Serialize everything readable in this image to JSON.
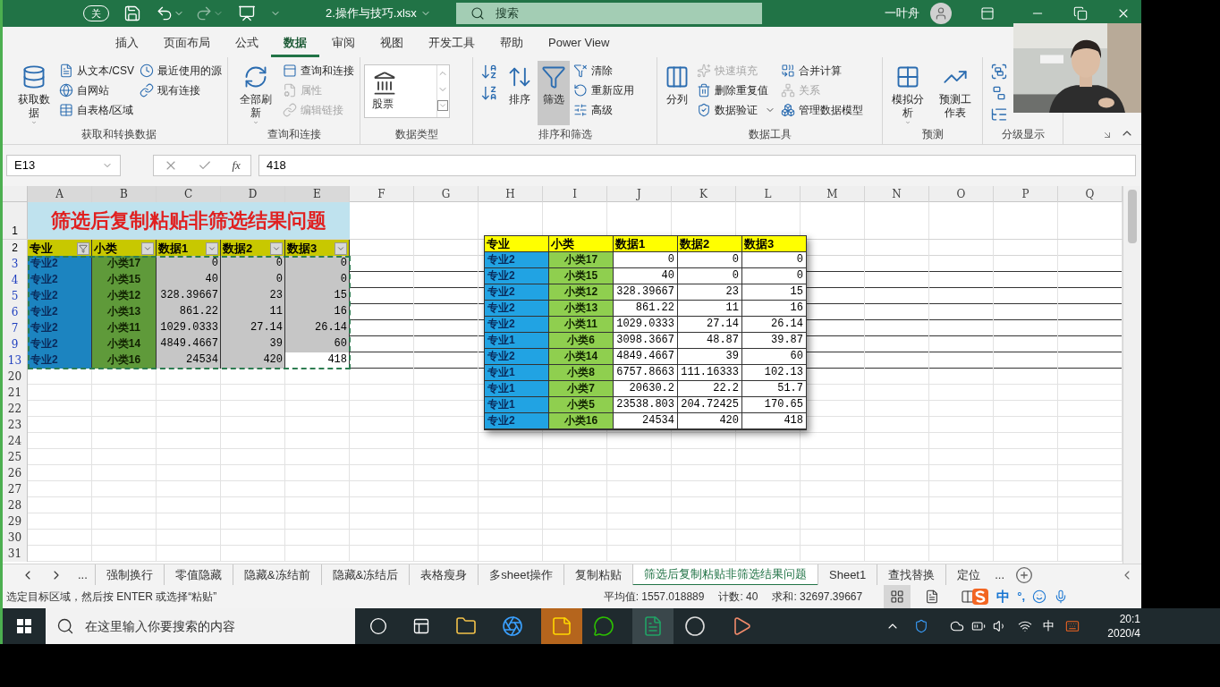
{
  "title_bar": {
    "autosave": "关",
    "filename": "2.操作与技巧.xlsx",
    "search": "搜索",
    "user": "一叶舟"
  },
  "ribbon_tabs": [
    {
      "label": "插入",
      "selected": false
    },
    {
      "label": "页面布局",
      "selected": false
    },
    {
      "label": "公式",
      "selected": false
    },
    {
      "label": "数据",
      "selected": true
    },
    {
      "label": "审阅",
      "selected": false
    },
    {
      "label": "视图",
      "selected": false
    },
    {
      "label": "开发工具",
      "selected": false
    },
    {
      "label": "帮助",
      "selected": false
    },
    {
      "label": "Power View",
      "selected": false
    }
  ],
  "ribbon": [
    {
      "label": "获取和转换数据",
      "columns": [
        [
          {
            "kind": "large",
            "label": "获取数据",
            "dropdown": true,
            "disabled": false,
            "pressed": false
          }
        ],
        [
          {
            "kind": "small",
            "label": "从文本/CSV",
            "dropdown": false,
            "disabled": false,
            "pressed": false
          },
          {
            "kind": "small",
            "label": "自网站",
            "dropdown": false,
            "disabled": false,
            "pressed": false
          },
          {
            "kind": "small",
            "label": "自表格/区域",
            "dropdown": false,
            "disabled": false,
            "pressed": false
          }
        ],
        [
          {
            "kind": "small",
            "label": "最近使用的源",
            "dropdown": false,
            "disabled": false,
            "pressed": false
          },
          {
            "kind": "small",
            "label": "现有连接",
            "dropdown": false,
            "disabled": false,
            "pressed": false
          }
        ]
      ]
    },
    {
      "label": "查询和连接",
      "columns": [
        [
          {
            "kind": "large",
            "label": "全部刷新",
            "dropdown": true,
            "disabled": false,
            "pressed": false
          }
        ],
        [
          {
            "kind": "small",
            "label": "查询和连接",
            "dropdown": false,
            "disabled": false,
            "pressed": false
          },
          {
            "kind": "small",
            "label": "属性",
            "dropdown": false,
            "disabled": true,
            "pressed": false
          },
          {
            "kind": "small",
            "label": "编辑链接",
            "dropdown": false,
            "disabled": true,
            "pressed": false
          }
        ]
      ]
    },
    {
      "label": "数据类型",
      "columns": [
        [
          {
            "kind": "gallery",
            "label": "股票"
          }
        ]
      ]
    },
    {
      "label": "排序和筛选",
      "columns": [
        [
          {
            "kind": "icon"
          },
          {
            "kind": "icon"
          }
        ],
        [
          {
            "kind": "large",
            "label": "排序",
            "dropdown": false,
            "disabled": false,
            "pressed": false
          }
        ],
        [
          {
            "kind": "large",
            "label": "筛选",
            "dropdown": false,
            "disabled": false,
            "pressed": true
          }
        ],
        [
          {
            "kind": "small",
            "label": "清除",
            "dropdown": false,
            "disabled": false,
            "pressed": false
          },
          {
            "kind": "small",
            "label": "重新应用",
            "dropdown": false,
            "disabled": false,
            "pressed": false
          },
          {
            "kind": "small",
            "label": "高级",
            "dropdown": false,
            "disabled": false,
            "pressed": false
          }
        ]
      ]
    },
    {
      "label": "数据工具",
      "columns": [
        [
          {
            "kind": "large",
            "label": "分列",
            "dropdown": false,
            "disabled": false,
            "pressed": false
          }
        ],
        [
          {
            "kind": "small",
            "label": "快速填充",
            "dropdown": false,
            "disabled": true,
            "pressed": false
          },
          {
            "kind": "small",
            "label": "删除重复值",
            "dropdown": false,
            "disabled": false,
            "pressed": false
          },
          {
            "kind": "small",
            "label": "数据验证",
            "dropdown": true,
            "disabled": false,
            "pressed": false
          }
        ],
        [
          {
            "kind": "small",
            "label": "合并计算",
            "dropdown": false,
            "disabled": false,
            "pressed": false
          },
          {
            "kind": "small",
            "label": "关系",
            "dropdown": false,
            "disabled": true,
            "pressed": false
          },
          {
            "kind": "small",
            "label": "管理数据模型",
            "dropdown": false,
            "disabled": false,
            "pressed": false
          }
        ]
      ]
    },
    {
      "label": "预测",
      "columns": [
        [
          {
            "kind": "large",
            "label": "模拟分析",
            "dropdown": true,
            "disabled": false,
            "pressed": false
          }
        ],
        [
          {
            "kind": "large",
            "label": "预测工作表",
            "dropdown": false,
            "disabled": false,
            "pressed": false
          }
        ]
      ]
    },
    {
      "label": "分级显示",
      "columns": [
        [
          {
            "kind": "icon"
          },
          {
            "kind": "icon"
          },
          {
            "kind": "icon"
          }
        ]
      ]
    }
  ],
  "formula_bar": {
    "name_box": "E13",
    "fx": "fx",
    "value": "418"
  },
  "sheet": {
    "columns": [
      "A",
      "B",
      "C",
      "D",
      "E",
      "F",
      "G",
      "H",
      "I",
      "J",
      "K",
      "L",
      "M",
      "N",
      "O",
      "P",
      "Q"
    ],
    "title_row": "1",
    "title": "筛选后复制粘贴非筛选结果问题",
    "header_row": "2",
    "headers": [
      {
        "label": "专业",
        "filtered": true
      },
      {
        "label": "小类",
        "filtered": false
      },
      {
        "label": "数据1",
        "filtered": false
      },
      {
        "label": "数据2",
        "filtered": false
      },
      {
        "label": "数据3",
        "filtered": false
      }
    ],
    "rows": [
      {
        "number": "3",
        "filtered": true,
        "cells": [
          {
            "text": "专业2",
            "active": false
          },
          {
            "text": "小类17",
            "active": false
          },
          {
            "text": "0",
            "active": false
          },
          {
            "text": "0",
            "active": false
          },
          {
            "text": "0",
            "active": false
          }
        ]
      },
      {
        "number": "4",
        "filtered": true,
        "cells": [
          {
            "text": "专业2",
            "active": false
          },
          {
            "text": "小类15",
            "active": false
          },
          {
            "text": "40",
            "active": false
          },
          {
            "text": "0",
            "active": false
          },
          {
            "text": "0",
            "active": false
          }
        ]
      },
      {
        "number": "5",
        "filtered": true,
        "cells": [
          {
            "text": "专业2",
            "active": false
          },
          {
            "text": "小类12",
            "active": false
          },
          {
            "text": "328.39667",
            "active": false
          },
          {
            "text": "23",
            "active": false
          },
          {
            "text": "15",
            "active": false
          }
        ]
      },
      {
        "number": "6",
        "filtered": true,
        "cells": [
          {
            "text": "专业2",
            "active": false
          },
          {
            "text": "小类13",
            "active": false
          },
          {
            "text": "861.22",
            "active": false
          },
          {
            "text": "11",
            "active": false
          },
          {
            "text": "16",
            "active": false
          }
        ]
      },
      {
        "number": "7",
        "filtered": true,
        "cells": [
          {
            "text": "专业2",
            "active": false
          },
          {
            "text": "小类11",
            "active": false
          },
          {
            "text": "1029.0333",
            "active": false
          },
          {
            "text": "27.14",
            "active": false
          },
          {
            "text": "26.14",
            "active": false
          }
        ]
      },
      {
        "number": "9",
        "filtered": true,
        "cells": [
          {
            "text": "专业2",
            "active": false
          },
          {
            "text": "小类14",
            "active": false
          },
          {
            "text": "4849.4667",
            "active": false
          },
          {
            "text": "39",
            "active": false
          },
          {
            "text": "60",
            "active": false
          }
        ]
      },
      {
        "number": "13",
        "filtered": true,
        "cells": [
          {
            "text": "专业2",
            "active": false
          },
          {
            "text": "小类16",
            "active": false
          },
          {
            "text": "24534",
            "active": false
          },
          {
            "text": "420",
            "active": false
          },
          {
            "text": "418",
            "active": true
          }
        ]
      },
      {
        "number": "20",
        "filtered": false
      },
      {
        "number": "21",
        "filtered": false
      },
      {
        "number": "22",
        "filtered": false
      },
      {
        "number": "23",
        "filtered": false
      },
      {
        "number": "24",
        "filtered": false
      },
      {
        "number": "25",
        "filtered": false
      },
      {
        "number": "26",
        "filtered": false
      },
      {
        "number": "27",
        "filtered": false
      },
      {
        "number": "28",
        "filtered": false
      },
      {
        "number": "29",
        "filtered": false
      },
      {
        "number": "30",
        "filtered": false
      },
      {
        "number": "31",
        "filtered": false
      }
    ]
  },
  "pasted_picture": {
    "headers": [
      "专业",
      "小类",
      "数据1",
      "数据2",
      "数据3"
    ],
    "rows": [
      [
        "专业2",
        "小类17",
        "0",
        "0",
        "0"
      ],
      [
        "专业2",
        "小类15",
        "40",
        "0",
        "0"
      ],
      [
        "专业2",
        "小类12",
        "328.39667",
        "23",
        "15"
      ],
      [
        "专业2",
        "小类13",
        "861.22",
        "11",
        "16"
      ],
      [
        "专业2",
        "小类11",
        "1029.0333",
        "27.14",
        "26.14"
      ],
      [
        "专业1",
        "小类6",
        "3098.3667",
        "48.87",
        "39.87"
      ],
      [
        "专业2",
        "小类14",
        "4849.4667",
        "39",
        "60"
      ],
      [
        "专业1",
        "小类8",
        "6757.8663",
        "111.16333",
        "102.13"
      ],
      [
        "专业1",
        "小类7",
        "20630.2",
        "22.2",
        "51.7"
      ],
      [
        "专业1",
        "小类5",
        "23538.803",
        "204.72425",
        "170.65"
      ],
      [
        "专业2",
        "小类16",
        "24534",
        "420",
        "418"
      ]
    ]
  },
  "sheet_tabs": {
    "more": "...",
    "tabs": [
      {
        "label": "强制换行",
        "selected": false
      },
      {
        "label": "零值隐藏",
        "selected": false
      },
      {
        "label": "隐藏&冻结前",
        "selected": false
      },
      {
        "label": "隐藏&冻结后",
        "selected": false
      },
      {
        "label": "表格瘦身",
        "selected": false
      },
      {
        "label": "多sheet操作",
        "selected": false
      },
      {
        "label": "复制粘贴",
        "selected": false
      },
      {
        "label": "筛选后复制粘贴非筛选结果问题",
        "selected": true
      },
      {
        "label": "Sheet1",
        "selected": false
      },
      {
        "label": "查找替换",
        "selected": false
      },
      {
        "label": "定位",
        "selected": false
      }
    ],
    "overflow": "..."
  },
  "status_bar": {
    "message": "选定目标区域，然后按 ENTER 或选择“粘贴”",
    "average": "平均值: 1557.018889",
    "count": "计数: 40",
    "sum": "求和: 32697.39667"
  },
  "ime_bar": {
    "mode": "中",
    "punctuation": "°,"
  },
  "taskbar": {
    "search": "在这里输入你要搜索的内容",
    "input_language": "中",
    "time": "20:1",
    "date": "2020/4"
  }
}
